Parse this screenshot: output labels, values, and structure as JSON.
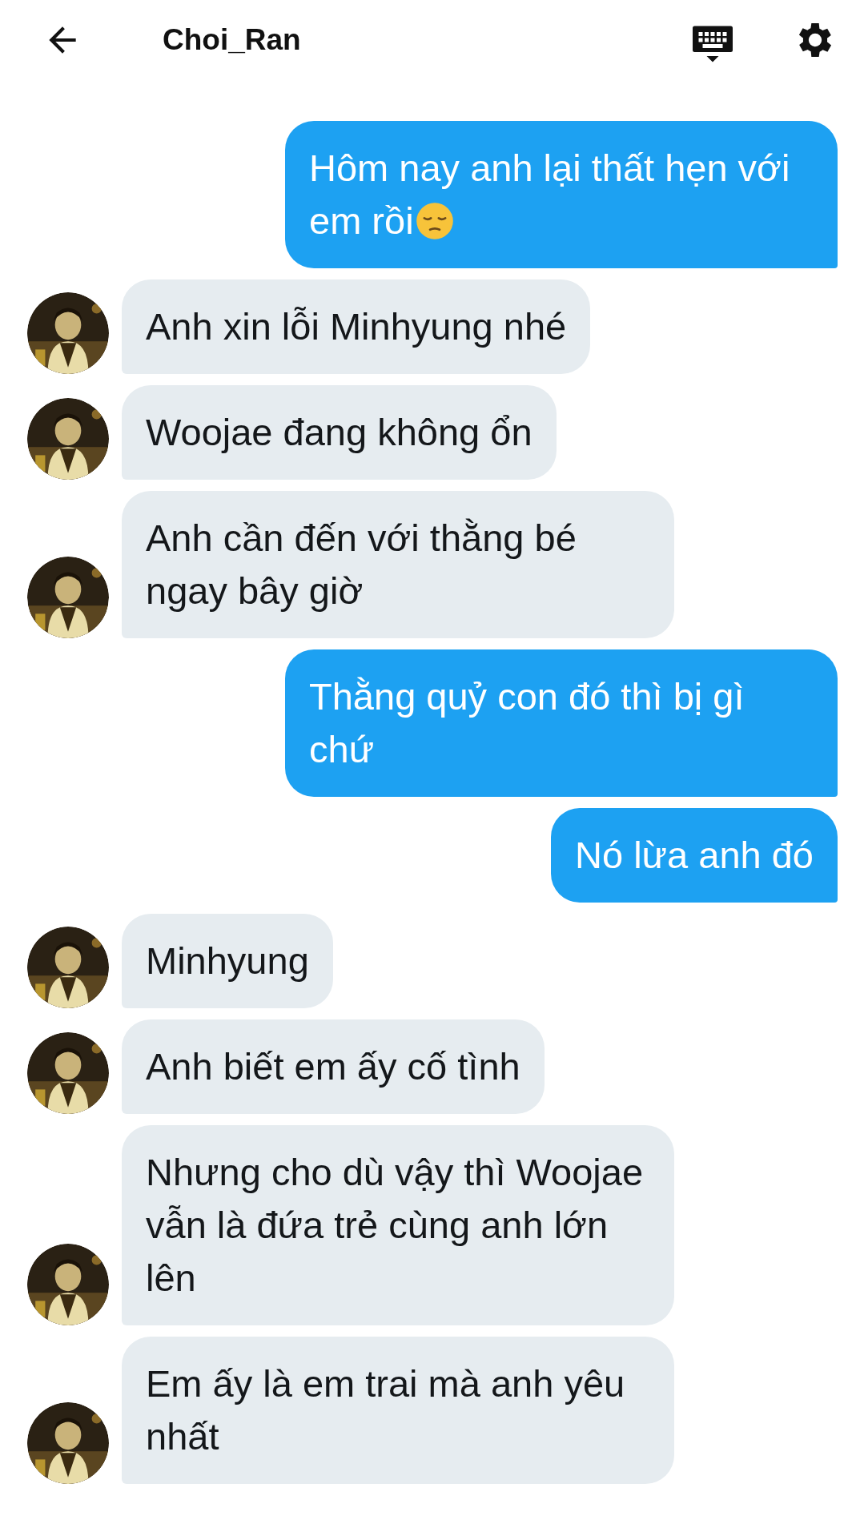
{
  "header": {
    "title": "Choi_Ran"
  },
  "messages": [
    {
      "kind": "sent_with_emoji",
      "text": "Hôm nay anh lại thất hẹn với em rồi"
    },
    {
      "kind": "received",
      "text": "Anh xin lỗi Minhyung nhé"
    },
    {
      "kind": "received",
      "text": "Woojae đang không ổn"
    },
    {
      "kind": "received",
      "text": "Anh cần đến với thằng bé ngay bây giờ"
    },
    {
      "kind": "sent",
      "text": "Thằng quỷ con đó thì bị gì chứ"
    },
    {
      "kind": "sent",
      "text": "Nó lừa anh đó"
    },
    {
      "kind": "received",
      "text": "Minhyung"
    },
    {
      "kind": "received",
      "text": "Anh biết em ấy cố tình"
    },
    {
      "kind": "received",
      "text": "Nhưng cho dù vậy thì Woojae vẫn là đứa trẻ cùng anh lớn lên"
    },
    {
      "kind": "received",
      "text": "Em ấy là em trai mà anh yêu nhất"
    }
  ]
}
